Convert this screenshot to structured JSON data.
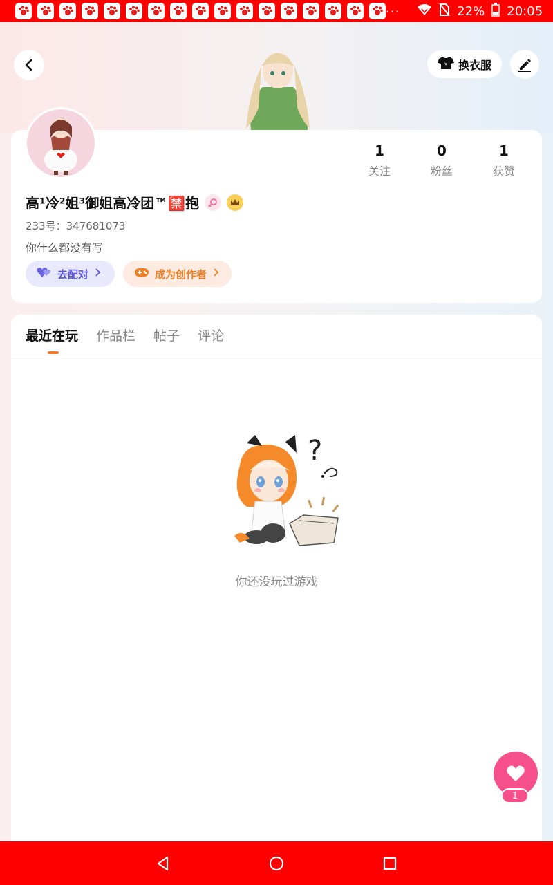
{
  "status_bar": {
    "battery": "22%",
    "time": "20:05",
    "overflow": "···",
    "notification_icons": 17
  },
  "header": {
    "outfit_label": "换衣服"
  },
  "profile": {
    "stats": [
      {
        "value": "1",
        "label": "关注"
      },
      {
        "value": "0",
        "label": "粉丝"
      },
      {
        "value": "1",
        "label": "获赞"
      }
    ],
    "nickname": "高¹冷²姐³御姐高冷团™🈲抱",
    "id_text": "233号：347681073",
    "bio": "你什么都没有写",
    "match_label": "去配对",
    "creator_label": "成为创作者"
  },
  "tabs": [
    {
      "label": "最近在玩",
      "active": true
    },
    {
      "label": "作品栏",
      "active": false
    },
    {
      "label": "帖子",
      "active": false
    },
    {
      "label": "评论",
      "active": false
    }
  ],
  "empty_state": {
    "message": "你还没玩过游戏"
  },
  "like": {
    "count": "1"
  },
  "colors": {
    "status_bar": "#ff0000",
    "accent_orange": "#f47a2e",
    "match_purple": "#5b57d8",
    "like_pink": "#f5508a"
  }
}
